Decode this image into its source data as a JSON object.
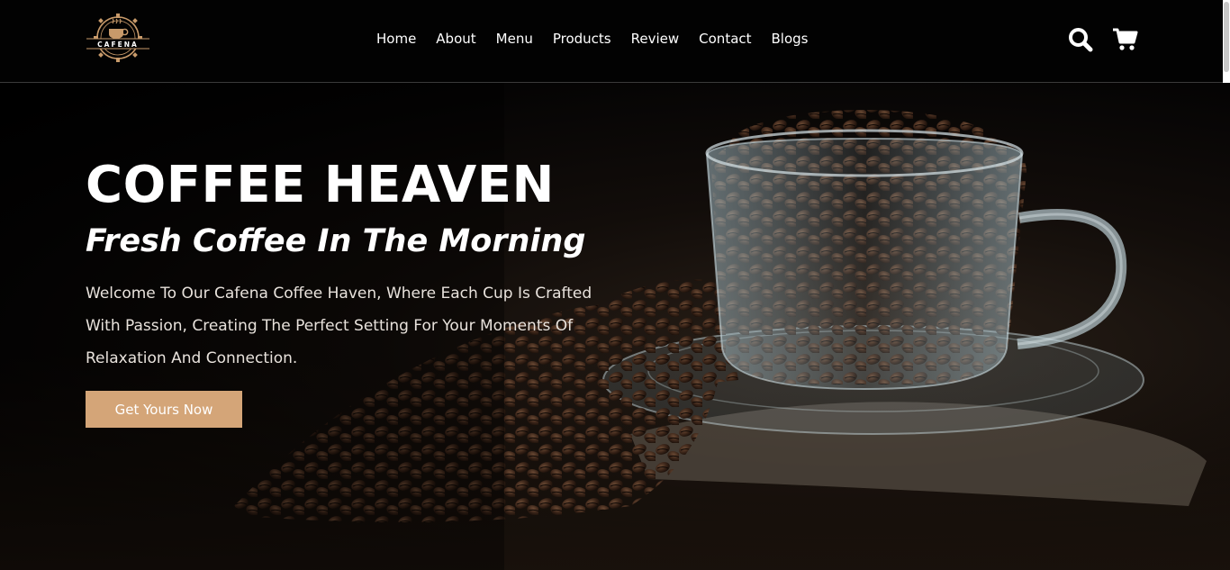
{
  "brand": {
    "logo_text": "CAFENA",
    "accent": "#d4a578"
  },
  "nav": {
    "items": [
      {
        "label": "Home"
      },
      {
        "label": "About"
      },
      {
        "label": "Menu"
      },
      {
        "label": "Products"
      },
      {
        "label": "Review"
      },
      {
        "label": "Contact"
      },
      {
        "label": "Blogs"
      }
    ]
  },
  "header_icons": {
    "search": "search-icon",
    "cart": "cart-icon"
  },
  "hero": {
    "title": "COFFEE HEAVEN",
    "subtitle": "Fresh Coffee In The Morning",
    "description": "Welcome To Our Cafena Coffee Haven, Where Each Cup Is Crafted With Passion, Creating The Perfect Setting For Your Moments Of Relaxation And Connection.",
    "cta_label": "Get Yours Now"
  }
}
